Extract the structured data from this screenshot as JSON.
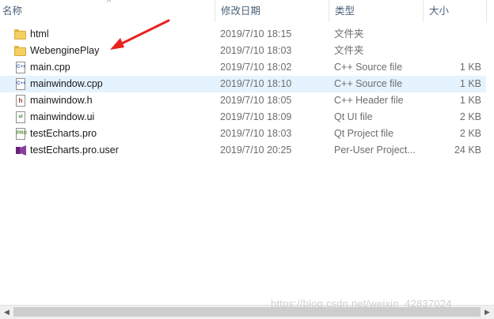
{
  "header": {
    "name": "名称",
    "date": "修改日期",
    "type": "类型",
    "size": "大小",
    "sort_glyph": "^"
  },
  "files": [
    {
      "name": "html",
      "date": "2019/7/10 18:15",
      "type": "文件夹",
      "size": "",
      "icon": "folder-icon"
    },
    {
      "name": "WebenginePlay",
      "date": "2019/7/10 18:03",
      "type": "文件夹",
      "size": "",
      "icon": "folder-icon"
    },
    {
      "name": "main.cpp",
      "date": "2019/7/10 18:02",
      "type": "C++ Source file",
      "size": "1 KB",
      "icon": "cpp-file-icon",
      "glyph": "C++"
    },
    {
      "name": "mainwindow.cpp",
      "date": "2019/7/10 18:10",
      "type": "C++ Source file",
      "size": "1 KB",
      "icon": "cpp-file-icon",
      "glyph": "C++",
      "selected": true
    },
    {
      "name": "mainwindow.h",
      "date": "2019/7/10 18:05",
      "type": "C++ Header file",
      "size": "1 KB",
      "icon": "header-file-icon",
      "glyph": "h"
    },
    {
      "name": "mainwindow.ui",
      "date": "2019/7/10 18:09",
      "type": "Qt UI file",
      "size": "2 KB",
      "icon": "ui-file-icon",
      "glyph": "ui"
    },
    {
      "name": "testEcharts.pro",
      "date": "2019/7/10 18:03",
      "type": "Qt Project file",
      "size": "2 KB",
      "icon": "pro-file-icon",
      "glyph": "PRO"
    },
    {
      "name": "testEcharts.pro.user",
      "date": "2019/7/10 20:25",
      "type": "Per-User Project...",
      "size": "24 KB",
      "icon": "visual-studio-icon"
    }
  ],
  "watermark": "https://blog.csdn.net/weixin_42837024",
  "colors": {
    "selection": "#e5f3ff",
    "arrow": "#e8231e",
    "folder": "#f5cf62"
  }
}
